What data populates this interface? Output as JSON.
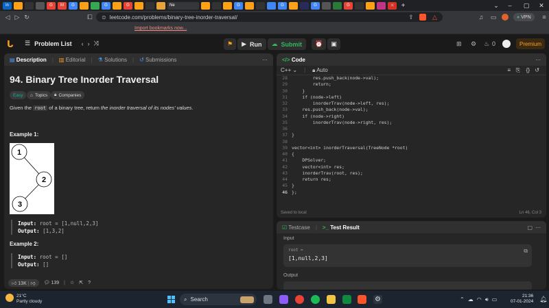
{
  "browser": {
    "active_tab_label": "Ne",
    "url": "leetcode.com/problems/binary-tree-inorder-traversal/",
    "vpn_label": "VPN",
    "bookmarks_link": "Import bookmarks now..."
  },
  "nav": {
    "problem_list": "Problem List",
    "run": "Run",
    "submit": "Submit",
    "streak": "0",
    "premium": "Premium"
  },
  "left": {
    "tabs": [
      "Description",
      "Editorial",
      "Solutions",
      "Submissions"
    ],
    "title": "94. Binary Tree Inorder Traversal",
    "chips": [
      "Easy",
      "Topics",
      "Companies"
    ],
    "desc_pre": "Given the ",
    "desc_code": "root",
    "desc_mid": " of a binary tree, return ",
    "desc_em": "the inorder traversal of its nodes' values",
    "desc_end": ".",
    "example1_heading": "Example 1:",
    "example1": {
      "input_label": "Input:",
      "input": " root = [1,null,2,3]",
      "output_label": "Output:",
      "output": " [1,3,2]"
    },
    "tree_nodes": [
      "1",
      "2",
      "3"
    ],
    "example2_heading": "Example 2:",
    "example2": {
      "input_label": "Input:",
      "input": " root = []",
      "output_label": "Output:",
      "output": " []"
    },
    "likes": "13K",
    "comments": "139"
  },
  "code": {
    "title": "Code",
    "language": "C++",
    "mode": "Auto",
    "lines": [
      {
        "n": "28",
        "t": "        res.push_back(node->val);"
      },
      {
        "n": "29",
        "t": "        return;"
      },
      {
        "n": "30",
        "t": "    }"
      },
      {
        "n": "31",
        "t": "    if (node->left)"
      },
      {
        "n": "32",
        "t": "        inorderTrav(node->left, res);"
      },
      {
        "n": "33",
        "t": "    res.push_back(node->val);"
      },
      {
        "n": "34",
        "t": "    if (node->right)"
      },
      {
        "n": "35",
        "t": "        inorderTrav(node->right, res);"
      },
      {
        "n": "36",
        "t": ""
      },
      {
        "n": "37",
        "t": "}"
      },
      {
        "n": "38",
        "t": ""
      },
      {
        "n": "39",
        "t": "vector<int> inorderTraversal(TreeNode *root)"
      },
      {
        "n": "40",
        "t": "{"
      },
      {
        "n": "41",
        "t": "    DPSolver;"
      },
      {
        "n": "42",
        "t": "    vector<int> res;"
      },
      {
        "n": "43",
        "t": "    inorderTrav(root, res);"
      },
      {
        "n": "44",
        "t": "    return res;"
      },
      {
        "n": "45",
        "t": "}"
      },
      {
        "n": "46",
        "t": "};"
      }
    ],
    "saved": "Saved to local",
    "cursor": "Ln 46, Col 3"
  },
  "test": {
    "tabs": [
      "Testcase",
      "Test Result"
    ],
    "input_label": "Input",
    "var_name": "root =",
    "var_value": "[1,null,2,3]",
    "output_label": "Output"
  },
  "taskbar": {
    "temp": "21°C",
    "weather": "Partly cloudy",
    "search": "Search",
    "time": "21:36",
    "date": "07-01-2024"
  }
}
